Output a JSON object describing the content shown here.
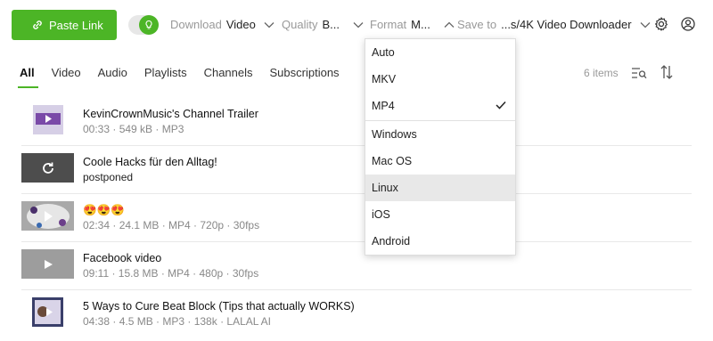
{
  "toolbar": {
    "paste_label": "Paste Link",
    "download_label": "Download",
    "download_value": "Video",
    "quality_label": "Quality",
    "quality_value": "B...",
    "format_label": "Format",
    "format_value": "M...",
    "save_label": "Save to",
    "save_value": "...s/4K Video Downloader"
  },
  "tabs": [
    "All",
    "Video",
    "Audio",
    "Playlists",
    "Channels",
    "Subscriptions"
  ],
  "active_tab": "All",
  "items_count": "6 items",
  "items": [
    {
      "title": "KevinCrownMusic's Channel Trailer",
      "meta": "00:33 · 549 kB · MP3"
    },
    {
      "title": "Coole Hacks für den Alltag!",
      "meta": "postponed"
    },
    {
      "title": "😍😍😍",
      "meta": "02:34 · 24.1 MB · MP4 · 720p · 30fps"
    },
    {
      "title": "Facebook video",
      "meta": "09:11 · 15.8 MB · MP4 · 480p · 30fps"
    },
    {
      "title": "5 Ways to Cure Beat Block (Tips that actually WORKS)",
      "meta": "04:38 · 4.5 MB · MP3 · 138k · LALAL AI"
    }
  ],
  "format_menu": {
    "items": [
      "Auto",
      "MKV",
      "MP4",
      "Windows",
      "Mac OS",
      "Linux",
      "iOS",
      "Android"
    ],
    "checked": "MP4",
    "highlighted": "Linux"
  },
  "colors": {
    "accent": "#4cb526"
  }
}
